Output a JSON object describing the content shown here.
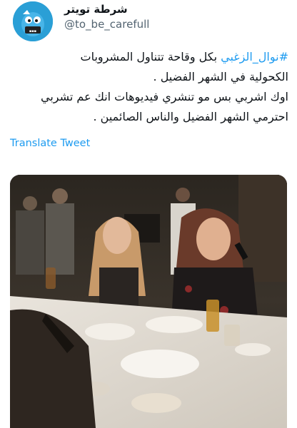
{
  "tweet": {
    "display_name": "شرطة تويتر",
    "handle": "@to_be_carefull",
    "hashtag": "#نوال_الزغبي",
    "line1_rest": " بكل وقاحة تتناول المشروبات",
    "line2": "الكحولية في الشهر الفضيل .",
    "line3": "اوك اشربي بس مو تنشري فيديوهات انك عم تشربي",
    "line4": "احترمي الشهر الفضيل والناس الصائمين .",
    "translate_label": "Translate Tweet"
  },
  "avatar": {
    "icon": "cartoon-bird-avatar",
    "bg_color": "#2a9fd6"
  },
  "media": {
    "type": "photo",
    "description_icon": "restaurant-scene-photo"
  },
  "colors": {
    "link": "#1d9bf0",
    "secondary": "#536471",
    "text": "#0f1419"
  }
}
